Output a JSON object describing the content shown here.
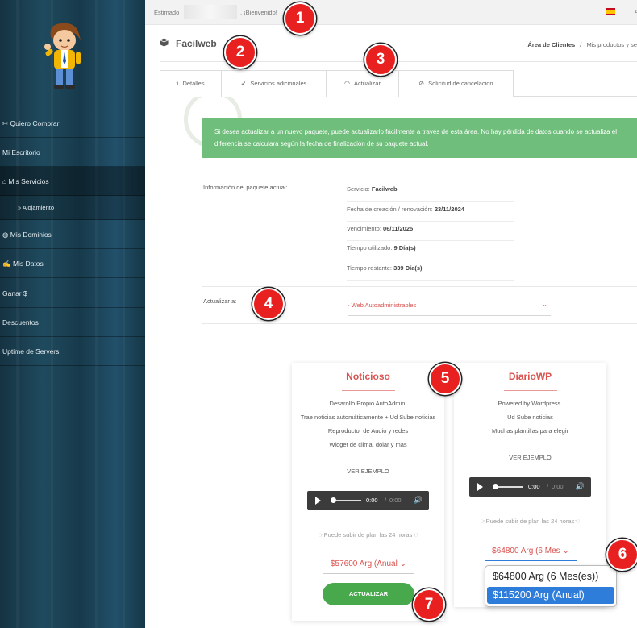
{
  "topbar": {
    "greeting_prefix": "Estimado",
    "greeting_suffix": ", ¡Bienvenido!",
    "right_text": "A"
  },
  "sidebar": {
    "items": [
      {
        "icon": "✂",
        "label": "Quiero Comprar"
      },
      {
        "icon": "",
        "label": "Mi Escritorio"
      },
      {
        "icon": "⌂",
        "label": "Mis Servicios"
      },
      {
        "icon": "»",
        "label": "Alojamiento"
      },
      {
        "icon": "◍",
        "label": "Mis Dominios"
      },
      {
        "icon": "✍",
        "label": "Mis Datos"
      },
      {
        "icon": "",
        "label": "Ganar $"
      },
      {
        "icon": "",
        "label": "Descuentos"
      },
      {
        "icon": "",
        "label": "Uptime de Servers"
      }
    ]
  },
  "page": {
    "title": "Facilweb",
    "breadcrumb_home": "Área de Clientes",
    "breadcrumb_sep": "/",
    "breadcrumb_current": "Mis productos y se"
  },
  "tabs": [
    {
      "icon": "ℹ",
      "label": "Detalles"
    },
    {
      "icon": "➶",
      "label": "Servicios adicionales"
    },
    {
      "icon": "◠",
      "label": "Actualizar"
    },
    {
      "icon": "⊘",
      "label": "Solicitud de cancelacion"
    }
  ],
  "alert": {
    "line1": "Si desea actualizar a un nuevo paquete, puede actualizarlo fácilmente a través de esta área. No hay pérdida de datos cuando se actualiza el",
    "line2": "diferencia se calculará según la fecha de finalización de su paquete actual."
  },
  "package_info": {
    "label": "Información del paquete actual:",
    "rows": [
      {
        "key": "Servicio:",
        "value": "Facilweb"
      },
      {
        "key": "Fecha de creación / renovación:",
        "value": "23/11/2024"
      },
      {
        "key": "Vencimiento:",
        "value": "06/11/2025"
      },
      {
        "key": "Tiempo utilizado:",
        "value": "9 Día(s)"
      },
      {
        "key": "Tiempo restante:",
        "value": "339 Día(s)"
      }
    ]
  },
  "upgrade": {
    "label": "Actualizar a:",
    "selected": "- Web Autoadministrables",
    "chevron": "⌄"
  },
  "plans": [
    {
      "title": "Noticioso",
      "features": [
        "Desarollo Propio AutoAdmin.",
        "Trae noticias automáticamente + Ud Sube noticias",
        "Reproductor de Audio y redes",
        "Widget de clima, dolar y mas"
      ],
      "example": "VER EJEMPLO",
      "audio_current": "0:00",
      "audio_total": "0:00",
      "note": "☞Puede subir de plan las 24 horas☜",
      "price": "$57600 Arg (Anual",
      "button": "ACTUALIZAR"
    },
    {
      "title": "DiarioWP",
      "features": [
        "Powered by Wordpress.",
        "Ud Sube noticias",
        "Muchas plantillas para elegir"
      ],
      "example": "VER EJEMPLO",
      "audio_current": "0:00",
      "audio_total": "0:00",
      "note": "☞Puede subir de plan las 24 horas☜",
      "price": "$64800 Arg (6 Mes",
      "dropdown_options": [
        "$64800 Arg (6 Mes(es))",
        "$115200 Arg (Anual)"
      ],
      "dropdown_highlighted": "$115200 Arg (Anual)"
    }
  ],
  "markers": [
    "1",
    "2",
    "3",
    "4",
    "5",
    "6",
    "7"
  ],
  "colors": {
    "accent_red": "#d9534f",
    "alert_green": "#6fbe7b",
    "button_green": "#48a94c",
    "marker_red": "#e8201f",
    "option_highlight": "#2f7ddb"
  }
}
